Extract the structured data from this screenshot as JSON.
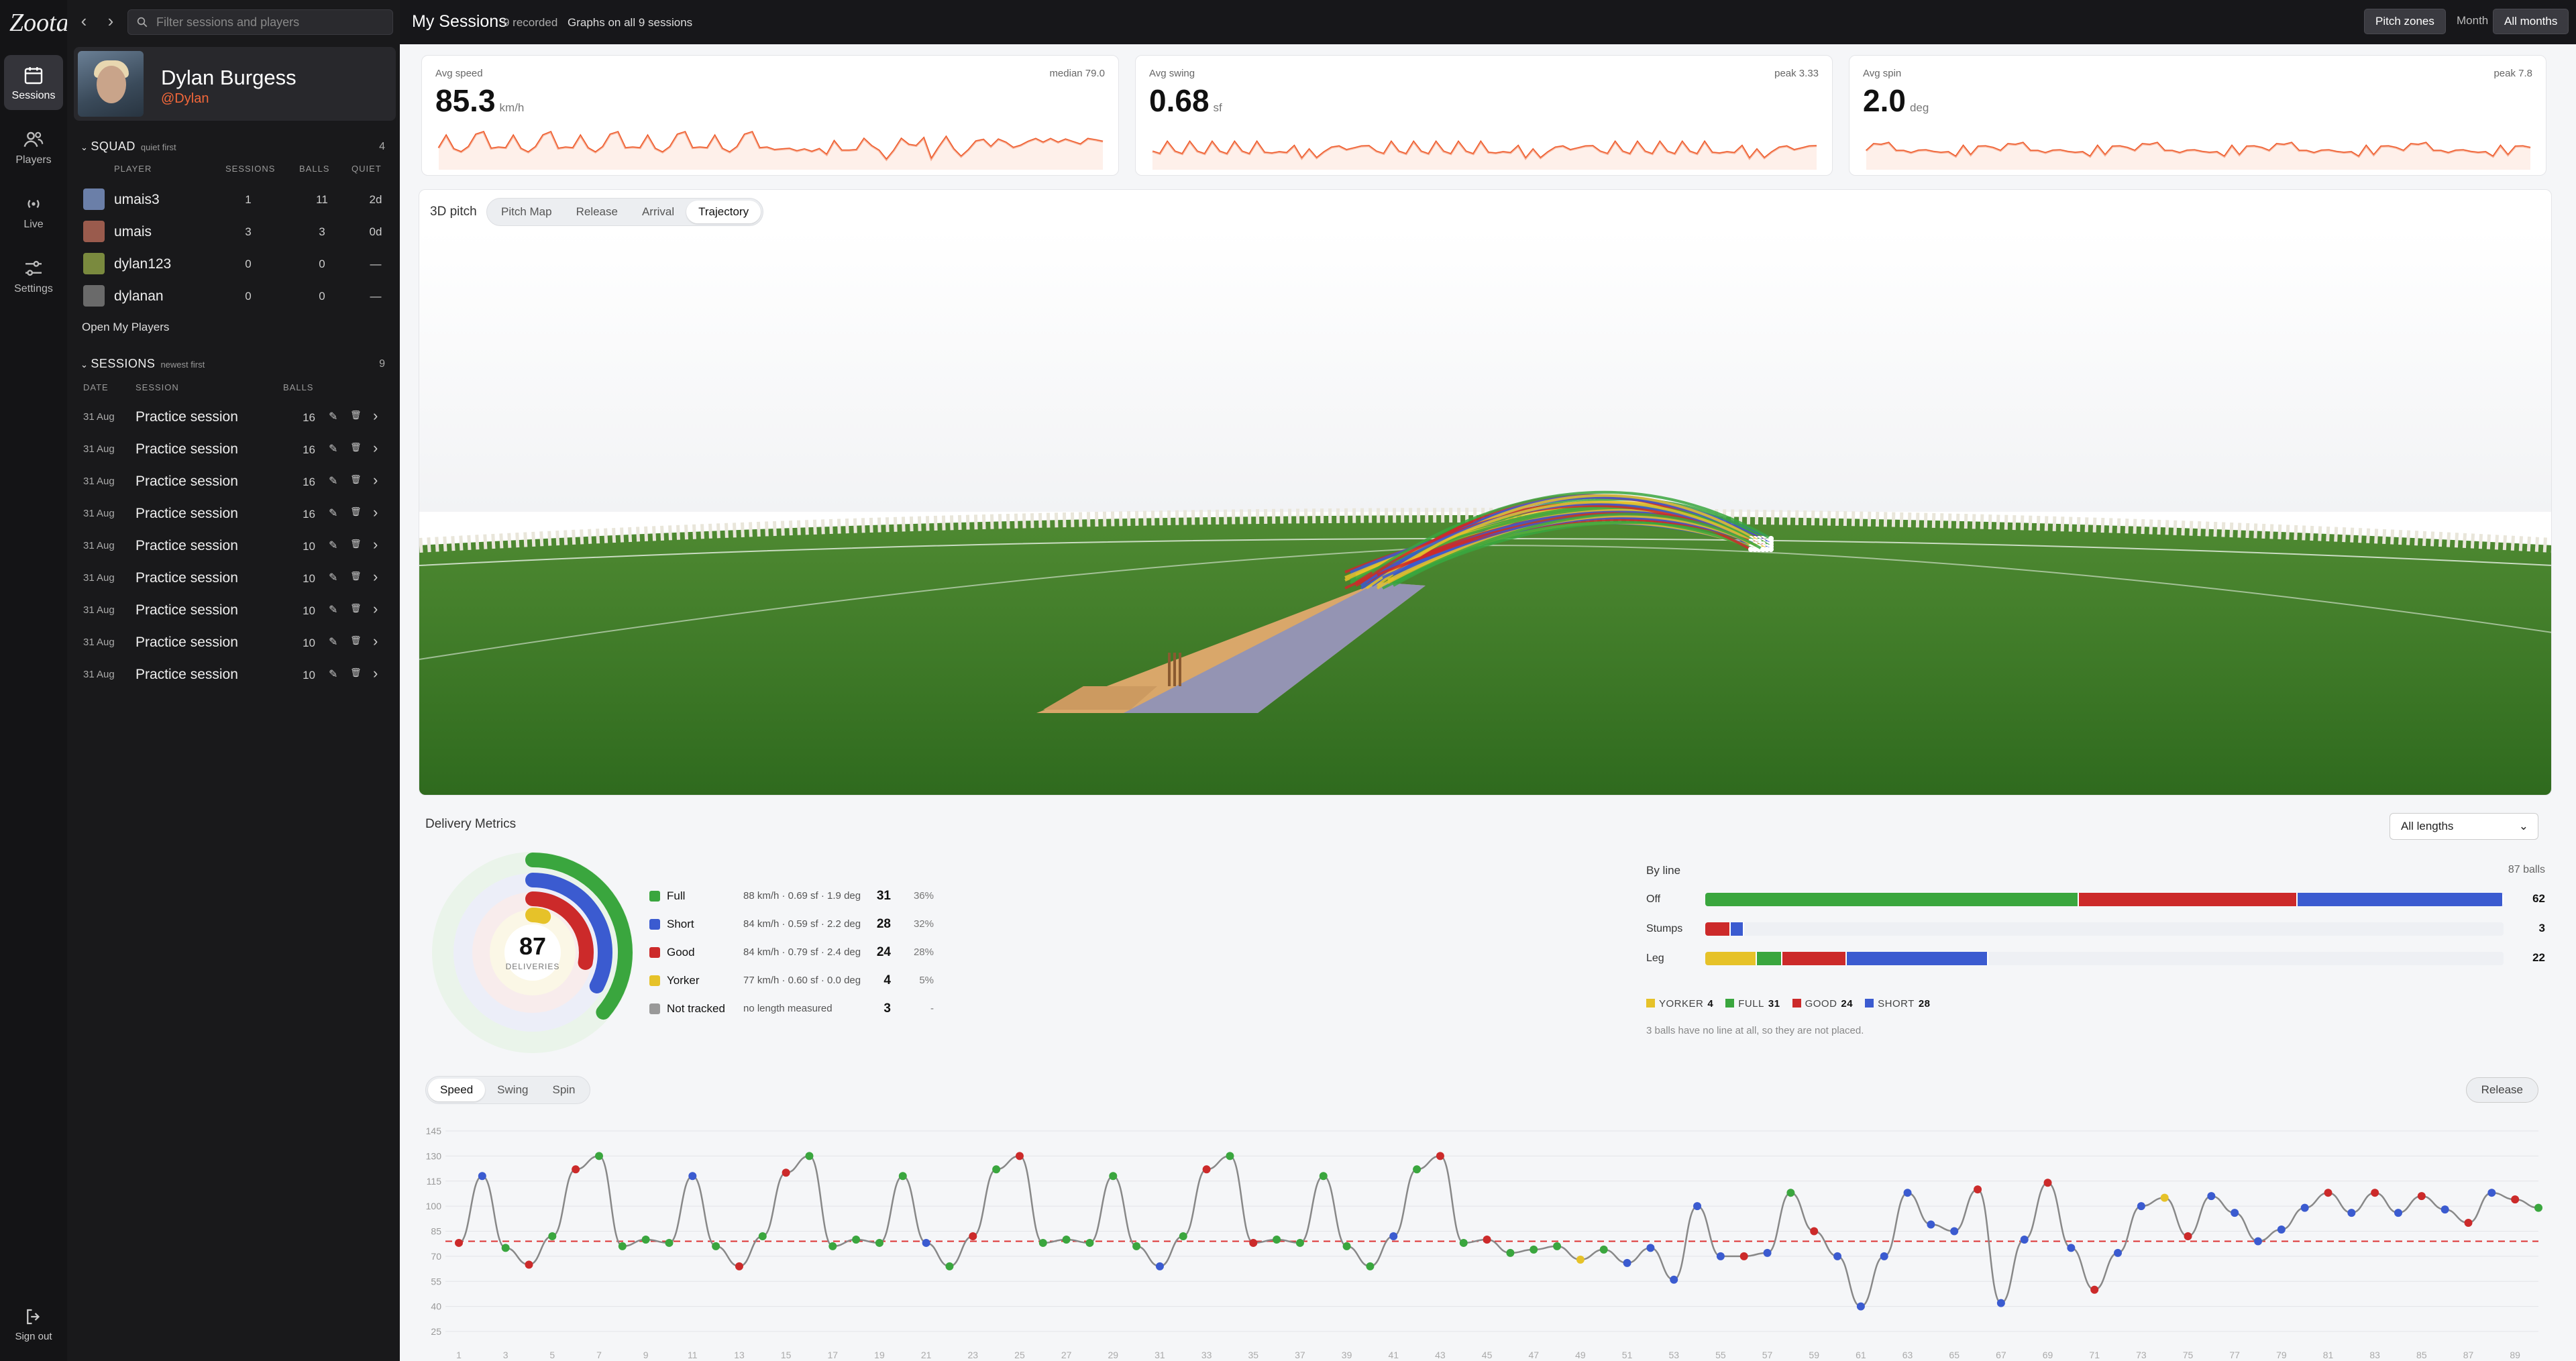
{
  "app": {
    "logo": "Zoota"
  },
  "rail": {
    "items": [
      {
        "label": "Sessions",
        "icon": "calendar-icon",
        "active": true
      },
      {
        "label": "Players",
        "icon": "users-icon",
        "active": false
      },
      {
        "label": "Live",
        "icon": "broadcast-icon",
        "active": false
      },
      {
        "label": "Settings",
        "icon": "sliders-icon",
        "active": false
      }
    ],
    "signout": "Sign out"
  },
  "search": {
    "placeholder": "Filter sessions and players"
  },
  "profile": {
    "name": "Dylan Burgess",
    "handle": "@Dylan"
  },
  "squad": {
    "title": "SQUAD",
    "subtitle": "quiet first",
    "count": "4",
    "columns": {
      "player": "PLAYER",
      "sessions": "SESSIONS",
      "balls": "BALLS",
      "quiet": "QUIET"
    },
    "players": [
      {
        "name": "umais3",
        "sessions": "1",
        "balls": "11",
        "quiet": "2d"
      },
      {
        "name": "umais",
        "sessions": "3",
        "balls": "3",
        "quiet": "0d"
      },
      {
        "name": "dylan123",
        "sessions": "0",
        "balls": "0",
        "quiet": "—"
      },
      {
        "name": "dylanan",
        "sessions": "0",
        "balls": "0",
        "quiet": "—"
      }
    ],
    "open": "Open My Players"
  },
  "sessions": {
    "title": "SESSIONS",
    "subtitle": "newest first",
    "count": "9",
    "columns": {
      "date": "DATE",
      "session": "SESSION",
      "balls": "BALLS"
    },
    "rows": [
      {
        "date": "31 Aug",
        "name": "Practice session",
        "balls": "16"
      },
      {
        "date": "31 Aug",
        "name": "Practice session",
        "balls": "16"
      },
      {
        "date": "31 Aug",
        "name": "Practice session",
        "balls": "16"
      },
      {
        "date": "31 Aug",
        "name": "Practice session",
        "balls": "16"
      },
      {
        "date": "31 Aug",
        "name": "Practice session",
        "balls": "10"
      },
      {
        "date": "31 Aug",
        "name": "Practice session",
        "balls": "10"
      },
      {
        "date": "31 Aug",
        "name": "Practice session",
        "balls": "10"
      },
      {
        "date": "31 Aug",
        "name": "Practice session",
        "balls": "10"
      },
      {
        "date": "31 Aug",
        "name": "Practice session",
        "balls": "10"
      }
    ]
  },
  "header": {
    "title": "My Sessions",
    "recorded": "9 recorded",
    "graphs": "Graphs on all 9 sessions",
    "buttons": [
      "Pitch zones",
      "Month",
      "All months"
    ]
  },
  "stats": [
    {
      "label": "Avg speed",
      "peak": "median 79.0",
      "value": "85.3",
      "unit": "km/h"
    },
    {
      "label": "Avg swing",
      "peak": "peak 3.33",
      "value": "0.68",
      "unit": "sf"
    },
    {
      "label": "Avg spin",
      "peak": "peak 7.8",
      "value": "2.0",
      "unit": "deg"
    }
  ],
  "pitch": {
    "label": "3D pitch",
    "tabs": [
      {
        "label": "Pitch Map",
        "active": false
      },
      {
        "label": "Release",
        "active": false
      },
      {
        "label": "Arrival",
        "active": false
      },
      {
        "label": "Trajectory",
        "active": true
      }
    ]
  },
  "metrics": {
    "title": "Delivery Metrics",
    "filter": "All lengths",
    "total": "87",
    "total_label": "DELIVERIES",
    "lengths": [
      {
        "name": "Full",
        "stats": "88 km/h · 0.69 sf · 1.9 deg",
        "count": "31",
        "pct": "36%",
        "color": "#3aa63e"
      },
      {
        "name": "Short",
        "stats": "84 km/h · 0.59 sf · 2.2 deg",
        "count": "28",
        "pct": "32%",
        "color": "#3b5bd0"
      },
      {
        "name": "Good",
        "stats": "84 km/h · 0.79 sf · 2.4 deg",
        "count": "24",
        "pct": "28%",
        "color": "#cc2a2a"
      },
      {
        "name": "Yorker",
        "stats": "77 km/h · 0.60 sf · 0.0 deg",
        "count": "4",
        "pct": "5%",
        "color": "#e6c229"
      },
      {
        "name": "Not tracked",
        "stats": "no length measured",
        "count": "3",
        "pct": "-",
        "color": "#999999"
      }
    ],
    "byline": {
      "title": "By line",
      "total": "87 balls",
      "rows": [
        {
          "label": "Off",
          "total": "62",
          "segments": [
            {
              "k": "FULL",
              "v": 29
            },
            {
              "k": "GOOD",
              "v": 17
            },
            {
              "k": "SHORT",
              "v": 16
            }
          ]
        },
        {
          "label": "Stumps",
          "total": "3",
          "segments": [
            {
              "k": "GOOD",
              "v": 2
            },
            {
              "k": "SHORT",
              "v": 1
            }
          ]
        },
        {
          "label": "Leg",
          "total": "22",
          "segments": [
            {
              "k": "YORKER",
              "v": 4
            },
            {
              "k": "FULL",
              "v": 2
            },
            {
              "k": "GOOD",
              "v": 5
            },
            {
              "k": "SHORT",
              "v": 11
            }
          ]
        }
      ],
      "legend": [
        {
          "k": "YORKER",
          "v": "4"
        },
        {
          "k": "FULL",
          "v": "31"
        },
        {
          "k": "GOOD",
          "v": "24"
        },
        {
          "k": "SHORT",
          "v": "28"
        }
      ],
      "note": "3 balls have no line at all, so they are not placed."
    },
    "colors": {
      "FULL": "#3aa63e",
      "SHORT": "#3b5bd0",
      "GOOD": "#cc2a2a",
      "YORKER": "#e6c229"
    }
  },
  "speed": {
    "tabs": [
      {
        "label": "Speed",
        "active": true
      },
      {
        "label": "Swing",
        "active": false
      },
      {
        "label": "Spin",
        "active": false
      }
    ],
    "release": "Release"
  },
  "chart_data": {
    "type": "line",
    "metric": "speed",
    "yticks": [
      145,
      130,
      115,
      100,
      85,
      70,
      55,
      40,
      25
    ],
    "ylim": [
      25,
      145
    ],
    "reference_line": 79,
    "xticks": [
      1,
      3,
      5,
      7,
      9,
      11,
      13,
      15,
      17,
      19,
      21,
      23,
      25,
      27,
      29,
      31,
      33,
      35,
      37,
      39,
      41,
      43,
      45,
      47,
      49,
      51,
      53,
      55,
      57,
      59,
      61,
      63,
      65,
      67,
      69,
      71,
      73,
      75,
      77,
      79,
      81,
      83,
      85,
      87,
      89
    ],
    "x": [
      1,
      2,
      3,
      4,
      5,
      6,
      7,
      8,
      9,
      10,
      11,
      12,
      13,
      14,
      15,
      16,
      17,
      18,
      19,
      20,
      21,
      22,
      23,
      24,
      25,
      26,
      27,
      28,
      29,
      30,
      31,
      32,
      33,
      34,
      35,
      36,
      37,
      38,
      39,
      40,
      41,
      42,
      43,
      44,
      45,
      46,
      47,
      48,
      49,
      50,
      51,
      52,
      53,
      54,
      55,
      56,
      57,
      58,
      59,
      60,
      61,
      62,
      63,
      64,
      65,
      66,
      67,
      68,
      69,
      70,
      71,
      72,
      73,
      74,
      75,
      76,
      77,
      78,
      79,
      80,
      81,
      82,
      83,
      84,
      85,
      86,
      87,
      88,
      89,
      90
    ],
    "y": [
      78,
      118,
      75,
      65,
      82,
      122,
      130,
      76,
      80,
      78,
      118,
      76,
      64,
      82,
      120,
      130,
      76,
      80,
      78,
      118,
      78,
      64,
      82,
      122,
      130,
      78,
      80,
      78,
      118,
      76,
      64,
      82,
      122,
      130,
      78,
      80,
      78,
      118,
      76,
      64,
      82,
      122,
      130,
      78,
      80,
      72,
      74,
      76,
      68,
      74,
      66,
      75,
      56,
      100,
      70,
      70,
      72,
      108,
      85,
      70,
      40,
      70,
      108,
      89,
      85,
      110,
      42,
      80,
      114,
      75,
      50,
      72,
      100,
      105,
      82,
      106,
      96,
      79,
      86,
      99,
      108,
      96,
      108,
      96,
      106,
      98,
      90,
      108,
      104,
      99
    ],
    "colors": [
      "GOOD",
      "SHORT",
      "FULL",
      "GOOD",
      "FULL",
      "GOOD",
      "FULL",
      "FULL",
      "FULL",
      "FULL",
      "SHORT",
      "FULL",
      "GOOD",
      "FULL",
      "GOOD",
      "FULL",
      "FULL",
      "FULL",
      "FULL",
      "FULL",
      "SHORT",
      "FULL",
      "GOOD",
      "FULL",
      "GOOD",
      "FULL",
      "FULL",
      "FULL",
      "FULL",
      "FULL",
      "SHORT",
      "FULL",
      "GOOD",
      "FULL",
      "GOOD",
      "FULL",
      "FULL",
      "FULL",
      "FULL",
      "FULL",
      "SHORT",
      "FULL",
      "GOOD",
      "FULL",
      "GOOD",
      "FULL",
      "FULL",
      "FULL",
      "YORKER",
      "FULL",
      "SHORT",
      "SHORT",
      "SHORT",
      "SHORT",
      "SHORT",
      "GOOD",
      "SHORT",
      "FULL",
      "GOOD",
      "SHORT",
      "SHORT",
      "SHORT",
      "SHORT",
      "SHORT",
      "SHORT",
      "GOOD",
      "SHORT",
      "SHORT",
      "GOOD",
      "SHORT",
      "GOOD",
      "SHORT",
      "SHORT",
      "YORKER",
      "GOOD",
      "SHORT",
      "SHORT",
      "SHORT",
      "SHORT",
      "SHORT",
      "GOOD",
      "SHORT",
      "GOOD",
      "SHORT",
      "GOOD",
      "SHORT",
      "GOOD",
      "SHORT",
      "GOOD",
      "FULL"
    ]
  }
}
